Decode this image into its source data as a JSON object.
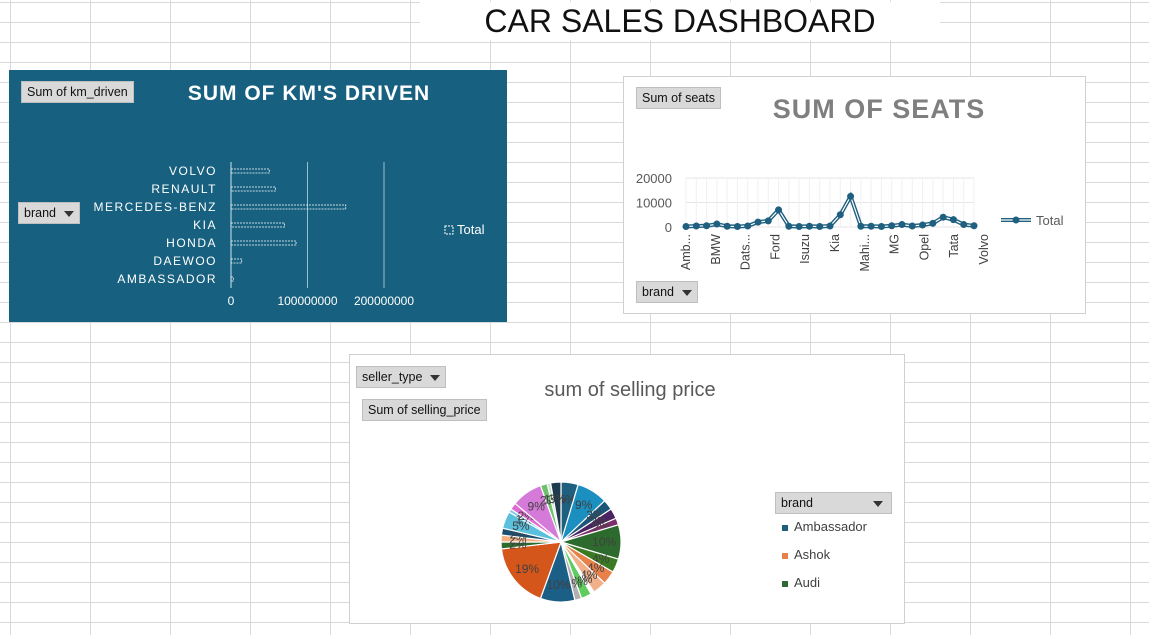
{
  "dashboard": {
    "title": "CAR SALES DASHBOARD"
  },
  "km_chart": {
    "value_button": "Sum of km_driven",
    "axis_button": "brand",
    "legend_label": "Total"
  },
  "seats_chart": {
    "value_button": "Sum of seats",
    "axis_button": "brand",
    "legend_label": "Total"
  },
  "price_chart": {
    "filter_button": "seller_type",
    "value_button": "Sum of selling_price",
    "legend_header": "brand",
    "legend_items": [
      {
        "label": "Ambassador",
        "color": "#1f5f7f"
      },
      {
        "label": "Ashok",
        "color": "#e8804a"
      },
      {
        "label": "Audi",
        "color": "#2d6a2d"
      }
    ]
  },
  "colors": {
    "km_bg": "#17607f",
    "line": "#1f5f7f",
    "seats_title": "#7f7f7f"
  },
  "chart_data": [
    {
      "type": "bar",
      "orientation": "horizontal",
      "title": "SUM OF KM'S DRIVEN",
      "categories": [
        "VOLVO",
        "RENAULT",
        "MERCEDES-BENZ",
        "KIA",
        "HONDA",
        "DAEWOO",
        "AMBASSADOR"
      ],
      "series": [
        {
          "name": "Total",
          "values": [
            50000000,
            58000000,
            150000000,
            70000000,
            85000000,
            14000000,
            3000000
          ]
        }
      ],
      "x_ticks": [
        "0",
        "100000000",
        "200000000"
      ],
      "xlim": [
        0,
        200000000
      ],
      "grid": true,
      "legend_position": "right"
    },
    {
      "type": "line",
      "title": "SUM OF SEATS",
      "categories": [
        "Amb...",
        "",
        "BMW",
        "",
        "Dats...",
        "",
        "Ford",
        "",
        "Isuzu",
        "",
        "Kia",
        "",
        "Mahi...",
        "",
        "MG",
        "",
        "Opel",
        "",
        "Tata",
        "",
        "Volvo"
      ],
      "series": [
        {
          "name": "Total",
          "values": [
            200,
            400,
            500,
            1200,
            300,
            200,
            400,
            2000,
            2500,
            7000,
            300,
            200,
            300,
            200,
            400,
            5000,
            12500,
            300,
            300,
            200,
            500,
            1000,
            400,
            800,
            1500,
            4000,
            3000,
            1000,
            500
          ]
        }
      ],
      "y_ticks": [
        "20000",
        "10000",
        "0"
      ],
      "ylim": [
        0,
        20000
      ],
      "grid": true,
      "legend_position": "right"
    },
    {
      "type": "pie",
      "title": "sum of selling price",
      "values": [
        5,
        9,
        3,
        3,
        2,
        10,
        4,
        4,
        4,
        1,
        3,
        2,
        10,
        19,
        2,
        2,
        2,
        5,
        1,
        2,
        9,
        2,
        1,
        3
      ],
      "colors": [
        "#1f5f7f",
        "#1a8fc0",
        "#1c5577",
        "#4a2460",
        "#7b2f6b",
        "#2d6a2d",
        "#3a7a22",
        "#e8804a",
        "#f0b08a",
        "#ffffff",
        "#5ecc5e",
        "#b0b0b0",
        "#1b5e86",
        "#d4561a",
        "#2e6a2e",
        "#f4b183",
        "#1b4f72",
        "#5bc0de",
        "#83cbeb",
        "#e06ad0",
        "#d67ad9",
        "#6fc16f",
        "#c9e6c9",
        "#1f3a4d"
      ],
      "labels": [
        "5%",
        "9%",
        "3%",
        "3%",
        "2%",
        "10%",
        "4%",
        "4%",
        "4%",
        "1%",
        "3%",
        "2%",
        "10%",
        "19%",
        "2%",
        "2%",
        "2%",
        "5%",
        "1%",
        "2%",
        "9%",
        "2%",
        "1%",
        "3%"
      ],
      "visible_labels": [
        "19%",
        "9%",
        "5%",
        "10%",
        "0%",
        "4%",
        "6%"
      ],
      "legend_position": "right"
    }
  ]
}
